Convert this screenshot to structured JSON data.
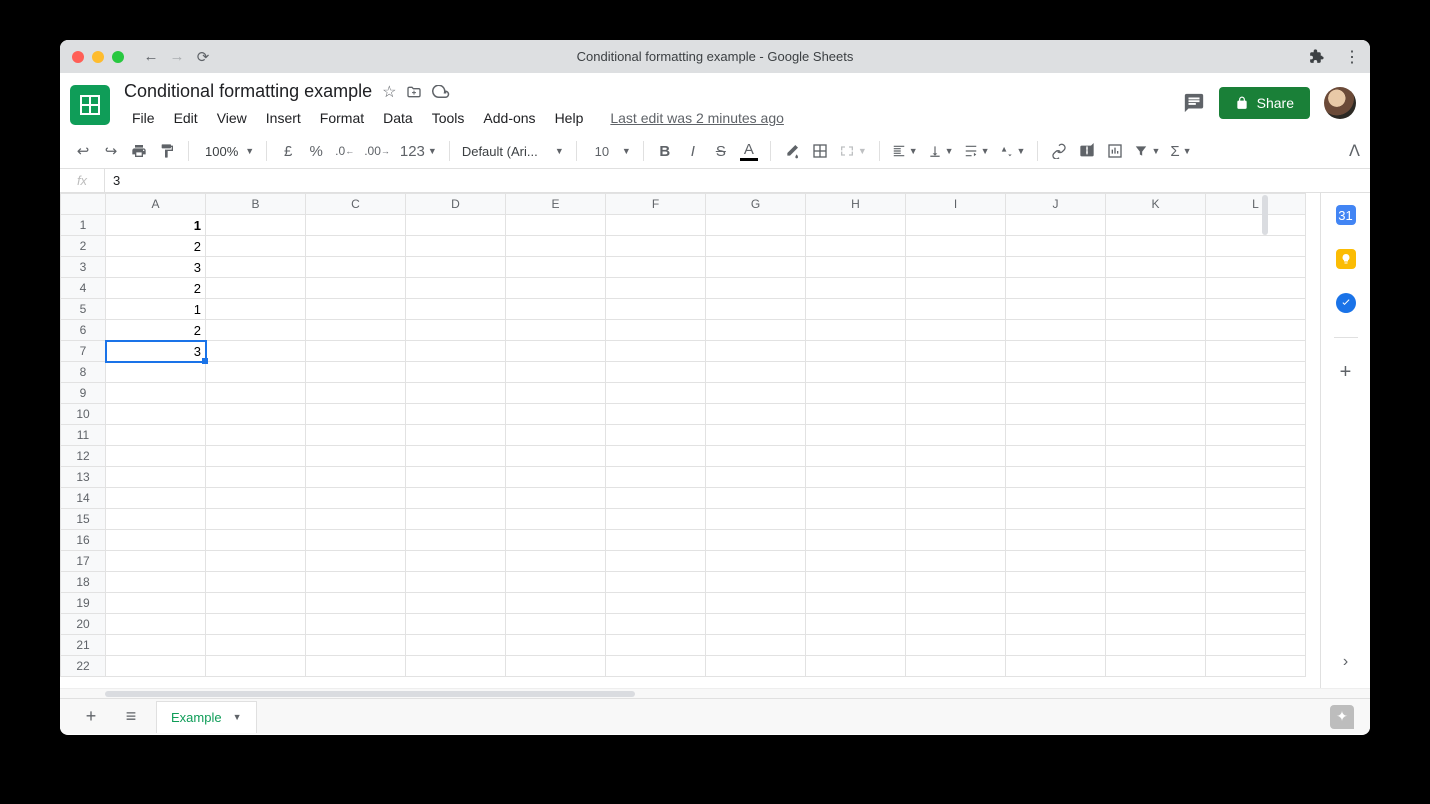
{
  "chrome": {
    "title": "Conditional formatting example - Google Sheets"
  },
  "doc": {
    "name": "Conditional formatting example",
    "last_edit": "Last edit was 2 minutes ago"
  },
  "menus": [
    "File",
    "Edit",
    "View",
    "Insert",
    "Format",
    "Data",
    "Tools",
    "Add-ons",
    "Help"
  ],
  "toolbar": {
    "zoom": "100%",
    "currency": "£",
    "percent": "%",
    "dec_dec": ".0",
    "inc_dec": ".00",
    "more_fmt": "123",
    "font": "Default (Ari...",
    "font_size": "10"
  },
  "share": {
    "label": "Share"
  },
  "formula": {
    "value": "3"
  },
  "columns": [
    "A",
    "B",
    "C",
    "D",
    "E",
    "F",
    "G",
    "H",
    "I",
    "J",
    "K",
    "L"
  ],
  "rows": 22,
  "cells": {
    "A1": "1",
    "A2": "2",
    "A3": "3",
    "A4": "2",
    "A5": "1",
    "A6": "2",
    "A7": "3"
  },
  "bold_cells": [
    "A1"
  ],
  "active_cell": "A7",
  "sheet": {
    "name": "Example"
  },
  "sidepanel": {
    "cal": "31"
  }
}
